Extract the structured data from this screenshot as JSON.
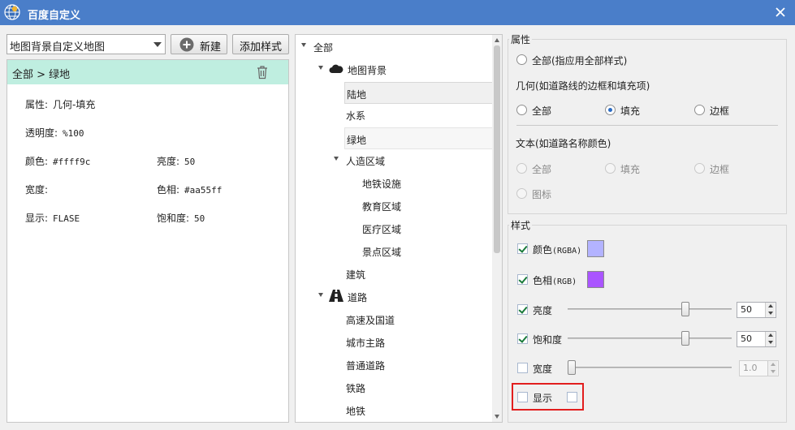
{
  "window": {
    "title": "百度自定义",
    "icon": "globe-icon",
    "close_icon": "close-icon"
  },
  "left": {
    "map_select": {
      "value": "地图背景自定义地图"
    },
    "new_button": {
      "label": "新建",
      "icon": "plus-circle-icon"
    },
    "add_style_button": {
      "label": "添加样式"
    },
    "breadcrumb": {
      "text": "全部 > 绿地",
      "delete_icon": "trash-icon"
    },
    "properties": {
      "attr": {
        "label": "属性:",
        "value": "几何-填充"
      },
      "opacity": {
        "label": "透明度:",
        "value": "%100"
      },
      "color": {
        "label": "颜色:",
        "value": "#ffff9c"
      },
      "brightness": {
        "label": "亮度:",
        "value": "50"
      },
      "width": {
        "label": "宽度:",
        "value": ""
      },
      "hue": {
        "label": "色相:",
        "value": "#aa55ff"
      },
      "display": {
        "label": "显示:",
        "value": "FLASE"
      },
      "saturation": {
        "label": "饱和度:",
        "value": "50"
      }
    }
  },
  "tree": {
    "items": [
      {
        "label": "全部"
      },
      {
        "label": "地图背景",
        "icon": "cloud-icon"
      },
      {
        "label": "陆地"
      },
      {
        "label": "水系"
      },
      {
        "label": "绿地"
      },
      {
        "label": "人造区域"
      },
      {
        "label": "地铁设施"
      },
      {
        "label": "教育区域"
      },
      {
        "label": "医疗区域"
      },
      {
        "label": "景点区域"
      },
      {
        "label": "建筑"
      },
      {
        "label": "道路",
        "icon": "road-icon"
      },
      {
        "label": "高速及国道"
      },
      {
        "label": "城市主路"
      },
      {
        "label": "普通道路"
      },
      {
        "label": "铁路"
      },
      {
        "label": "地铁"
      }
    ]
  },
  "attributes": {
    "title": "属性",
    "all_option": "全部(指应用全部样式)",
    "geometry_title": "几何(如道路线的边框和填充项)",
    "geometry_options": [
      "全部",
      "填充",
      "边框"
    ],
    "geometry_selected": "填充",
    "text_title": "文本(如道路名称颜色)",
    "text_options": [
      "全部",
      "填充",
      "边框",
      "图标"
    ]
  },
  "style": {
    "title": "样式",
    "color": {
      "label": "颜色",
      "sub": "(RGBA)",
      "checked": true,
      "swatch": "#b3b3ff"
    },
    "hue": {
      "label": "色相",
      "sub": "(RGB)",
      "checked": true,
      "swatch": "#aa55ff"
    },
    "brightness": {
      "label": "亮度",
      "checked": true,
      "value": "50",
      "level": 0.73
    },
    "saturation": {
      "label": "饱和度",
      "checked": true,
      "value": "50",
      "level": 0.73
    },
    "width": {
      "label": "宽度",
      "checked": false,
      "value": "1.0",
      "level": 0.0
    },
    "display": {
      "label": "显示",
      "checked": false
    }
  }
}
